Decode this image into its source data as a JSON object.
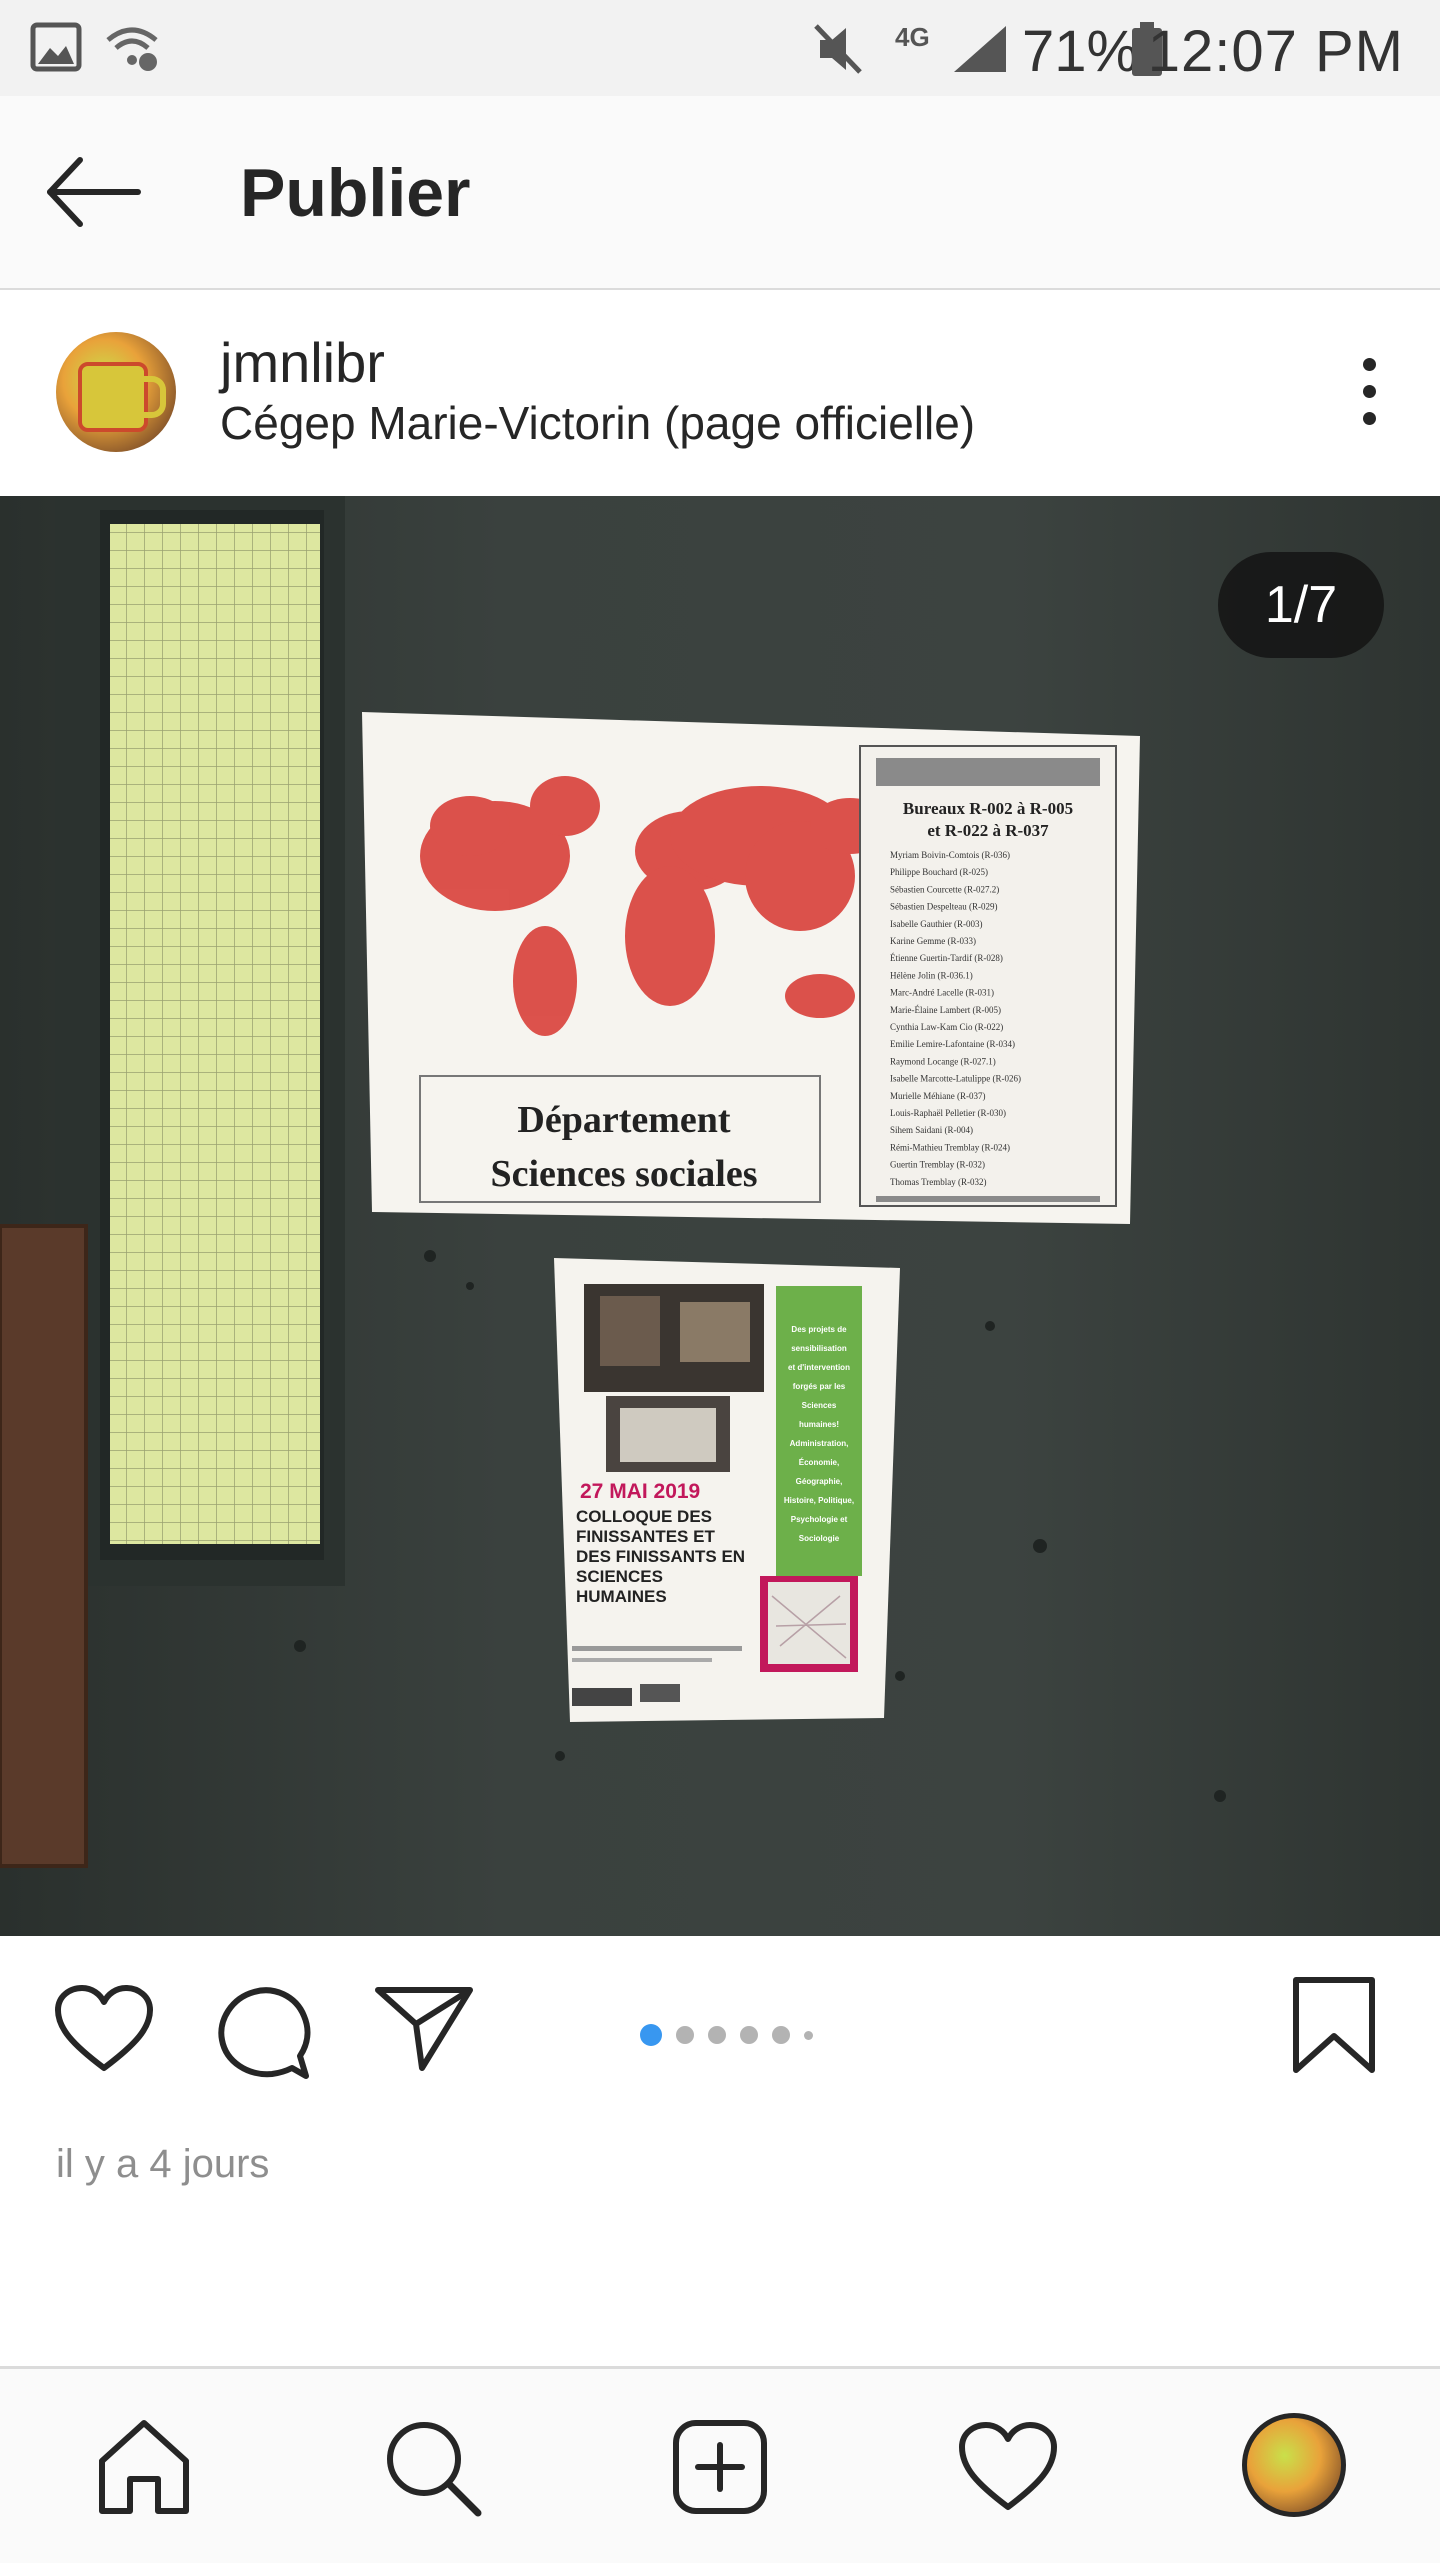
{
  "status_bar": {
    "network": "4G",
    "battery": "71%",
    "time": "12:07 PM"
  },
  "header": {
    "title": "Publier"
  },
  "post": {
    "username": "jmnlibr",
    "location": "Cégep Marie-Victorin (page officielle)",
    "counter": "1/7",
    "carousel": {
      "total_dots": 6,
      "active_index": 0
    },
    "timestamp": "il y a 4 jours",
    "photo": {
      "poster_title_line1": "Département",
      "poster_title_line2": "Sciences sociales",
      "office_heading_line1": "Bureaux R-002 à R-005",
      "office_heading_line2": "et R-022 à R-037",
      "staff": [
        "Myriam Boivin-Comtois (R-036)",
        "Philippe Bouchard (R-025)",
        "Sébastien Courcette (R-027.2)",
        "Sébastien Despelteau (R-029)",
        "Isabelle Gauthier (R-003)",
        "Karine Gemme (R-033)",
        "Étienne Guertin-Tardif (R-028)",
        "Hélène Jolin (R-036.1)",
        "Marc-André Lacelle (R-031)",
        "Marie-Élaine Lambert (R-005)",
        "Cynthia Law-Kam Cio (R-022)",
        "Emilie Lemire-Lafontaine (R-034)",
        "Raymond Locange (R-027.1)",
        "Isabelle Marcotte-Latulippe (R-026)",
        "Murielle Méhiane (R-037)",
        "Louis-Raphaël Pelletier (R-030)",
        "Sihem Saidani (R-004)",
        "Rémi-Mathieu Tremblay (R-024)",
        "Guertin Tremblay (R-032)",
        "Thomas Tremblay (R-032)"
      ],
      "flyer_date": "27 MAI 2019",
      "flyer_title": [
        "COLLOQUE DES",
        "FINISSANTES ET",
        "DES FINISSANTS EN",
        "SCIENCES",
        "HUMAINES"
      ],
      "flyer_side": [
        "Des projets de",
        "sensibilisation",
        "et d'intervention",
        "forgés par les",
        "Sciences",
        "humaines!",
        "Administration,",
        "Économie,",
        "Géographie,",
        "Histoire, Politique,",
        "Psychologie et",
        "Sociologie"
      ]
    }
  },
  "icons": {
    "gallery": "gallery-icon",
    "wifi": "wifi-question-icon",
    "mute": "mute-icon",
    "signal": "signal-icon",
    "battery": "battery-icon",
    "back": "back-arrow-icon",
    "more": "more-vertical-icon",
    "like": "heart-icon",
    "comment": "comment-icon",
    "share": "send-icon",
    "save": "bookmark-icon",
    "home": "home-icon",
    "search": "search-icon",
    "add": "add-post-icon",
    "activity": "activity-heart-icon"
  },
  "colors": {
    "accent_dot": "#3897f0",
    "flyer_pink": "#c2185b",
    "flyer_green": "#6db04a"
  }
}
